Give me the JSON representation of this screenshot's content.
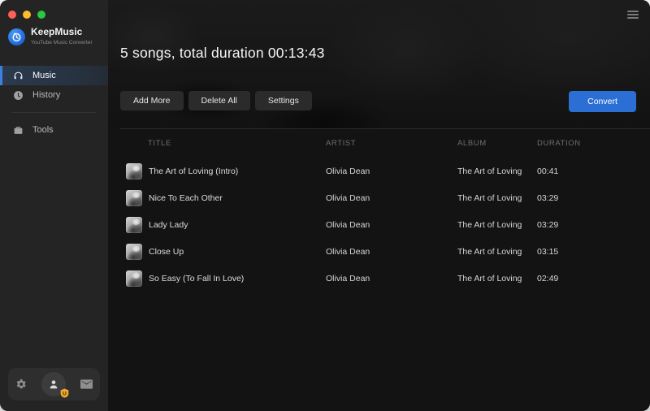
{
  "window": {
    "traffic_lights": [
      "close",
      "minimize",
      "zoom"
    ],
    "menu_icon": "hamburger-icon"
  },
  "sidebar": {
    "app_name": "KeepMusic",
    "app_subtitle": "YouTube Music Converter",
    "items": [
      {
        "label": "Music",
        "icon": "headphones-icon",
        "active": true
      },
      {
        "label": "History",
        "icon": "clock-icon",
        "active": false
      },
      {
        "label": "Tools",
        "icon": "toolbox-icon",
        "active": false
      }
    ],
    "footer_icons": [
      "gear-icon",
      "user-icon",
      "mail-icon"
    ],
    "user_badge_glyph": "U"
  },
  "header": {
    "summary": "5 songs, total duration 00:13:43"
  },
  "toolbar": {
    "add_more": "Add More",
    "delete_all": "Delete All",
    "settings": "Settings",
    "convert": "Convert"
  },
  "table": {
    "columns": [
      "TITLE",
      "ARTIST",
      "ALBUM",
      "DURATION"
    ],
    "rows": [
      {
        "title": "The Art of Loving (Intro)",
        "artist": "Olivia Dean",
        "album": "The Art of Loving",
        "duration": "00:41"
      },
      {
        "title": "Nice To Each Other",
        "artist": "Olivia Dean",
        "album": "The Art of Loving",
        "duration": "03:29"
      },
      {
        "title": "Lady Lady",
        "artist": "Olivia Dean",
        "album": "The Art of Loving",
        "duration": "03:29"
      },
      {
        "title": "Close Up",
        "artist": "Olivia Dean",
        "album": "The Art of Loving",
        "duration": "03:15"
      },
      {
        "title": "So Easy (To Fall In Love)",
        "artist": "Olivia Dean",
        "album": "The Art of Loving",
        "duration": "02:49"
      }
    ]
  },
  "colors": {
    "accent_blue": "#2b6fd4",
    "active_item_bar": "#3b82e0",
    "sidebar_bg": "#242424",
    "main_bg": "#131313",
    "badge_yellow": "#f0a830",
    "traffic_red": "#ff5f57",
    "traffic_yellow": "#febc2e",
    "traffic_green": "#28c840"
  }
}
